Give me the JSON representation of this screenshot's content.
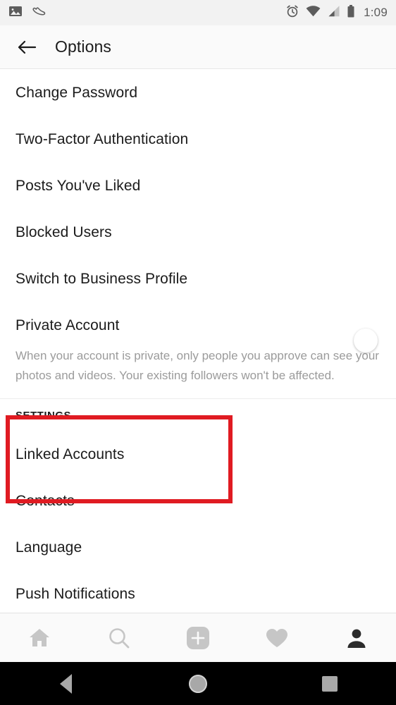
{
  "status_bar": {
    "left_icons": [
      {
        "name": "photo-icon",
        "label": "Screenshot captured"
      },
      {
        "name": "shoe-icon",
        "label": "Fitness tracker"
      }
    ],
    "right_icons": [
      {
        "name": "alarm-clock-icon",
        "label": "Alarm set"
      },
      {
        "name": "wifi-icon",
        "label": "Wi-Fi connected"
      },
      {
        "name": "cell-signal-icon",
        "label": "Mobile signal"
      },
      {
        "name": "battery-icon",
        "label": "Battery full"
      }
    ],
    "time": "1:09"
  },
  "toolbar": {
    "back_label": "Back",
    "title": "Options"
  },
  "main": {
    "items_top": [
      {
        "label": "Change Password"
      },
      {
        "label": "Two-Factor Authentication"
      },
      {
        "label": "Posts You've Liked"
      },
      {
        "label": "Blocked Users"
      },
      {
        "label": "Switch to Business Profile"
      }
    ],
    "private_account": {
      "label": "Private Account",
      "toggle_on": true,
      "toggle_color": "#3f93dd",
      "helper_text": "When your account is private, only people you approve can see your photos and videos. Your existing followers won't be affected."
    },
    "settings_section": {
      "header": "SETTINGS",
      "items": [
        {
          "label": "Linked Accounts"
        },
        {
          "label": "Contacts"
        },
        {
          "label": "Language"
        },
        {
          "label": "Push Notifications"
        }
      ]
    }
  },
  "annotation": {
    "highlight_color": "#e01b22",
    "target": "Linked Accounts"
  },
  "app_nav": {
    "items": [
      {
        "name": "home-icon",
        "label": "Home",
        "active": false
      },
      {
        "name": "search-icon",
        "label": "Search",
        "active": false
      },
      {
        "name": "add-post-icon",
        "label": "New Post",
        "active": false
      },
      {
        "name": "heart-icon",
        "label": "Activity",
        "active": false
      },
      {
        "name": "profile-icon",
        "label": "Profile",
        "active": true
      }
    ]
  },
  "system_nav": {
    "back_label": "Back",
    "home_label": "Home",
    "recents_label": "Recent apps"
  }
}
